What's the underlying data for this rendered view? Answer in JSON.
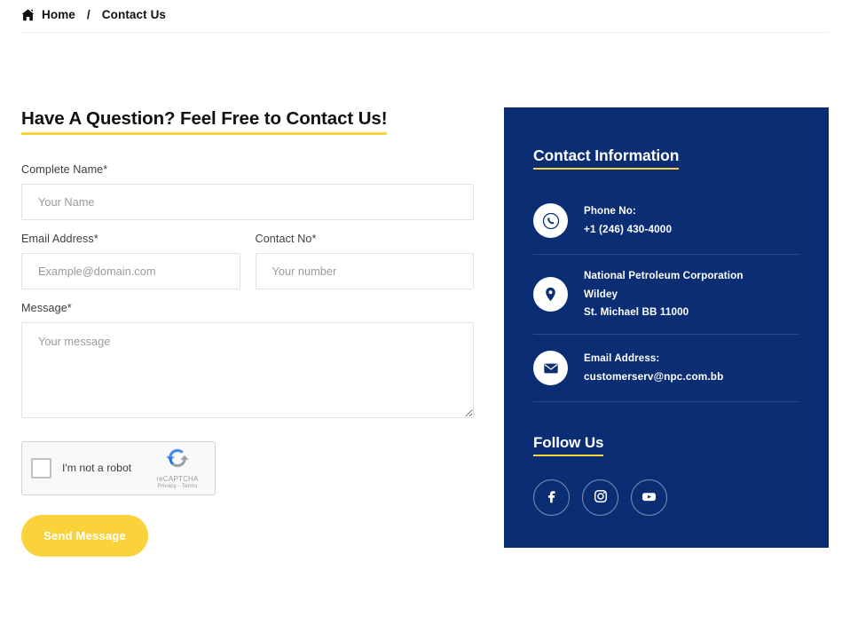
{
  "breadcrumb": {
    "home_label": "Home",
    "separator": "/",
    "current_label": "Contact Us",
    "home_icon": "home-icon"
  },
  "form": {
    "heading": "Have A Question? Feel Free to Contact Us!",
    "fields": [
      {
        "label": "Complete Name*",
        "placeholder": "Your Name",
        "value": ""
      },
      {
        "label": "Email Address*",
        "placeholder": "Example@domain.com",
        "value": ""
      },
      {
        "label": "Contact No*",
        "placeholder": "Your number",
        "value": ""
      },
      {
        "label": "Message*",
        "placeholder": "Your message",
        "value": ""
      }
    ],
    "recaptcha": {
      "checkbox_label": "I'm not a robot",
      "brand": "reCAPTCHA",
      "terms": "Privacy - Terms",
      "logo_icon": "recaptcha-logo-icon"
    },
    "submit_label": "Send Message"
  },
  "contact_panel": {
    "heading": "Contact Information",
    "phone": {
      "title": "Phone No:",
      "value": "+1 (246) 430-4000",
      "icon": "phone-icon"
    },
    "address": {
      "icon": "location-pin-icon",
      "line1": "National Petroleum Corporation",
      "line2": "Wildey",
      "line3": "St. Michael BB 11000"
    },
    "email": {
      "title": "Email Address:",
      "value": "customerserv@npc.com.bb",
      "icon": "envelope-icon"
    },
    "follow_heading": "Follow Us",
    "social": [
      {
        "name": "facebook",
        "icon": "facebook-icon"
      },
      {
        "name": "instagram",
        "icon": "instagram-icon"
      },
      {
        "name": "youtube",
        "icon": "youtube-icon"
      }
    ]
  },
  "colors": {
    "navy": "#0b2d73",
    "yellow": "#fad23c",
    "text": "#111111",
    "placeholder": "#9a9a9a",
    "border": "#e2e2e2"
  }
}
